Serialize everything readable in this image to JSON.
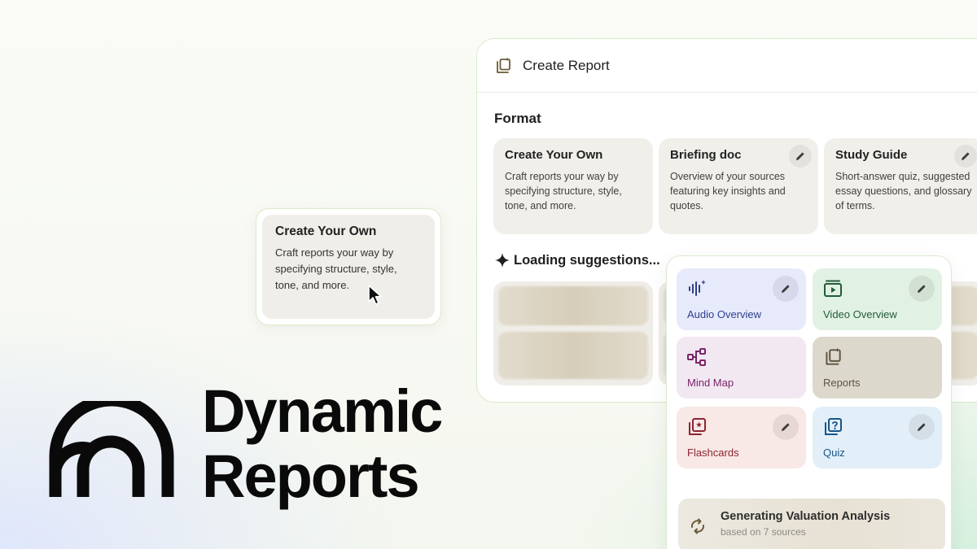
{
  "hero": {
    "title_line1": "Dynamic",
    "title_line2": "Reports",
    "logo_icon": "arches-logo-icon"
  },
  "report_panel": {
    "title": "Create Report",
    "title_icon": "report-sparkle-icon",
    "format_label": "Format",
    "format_cards": [
      {
        "title": "Create Your Own",
        "description": "Craft reports your way by specifying structure, style, tone, and more.",
        "editable": false
      },
      {
        "title": "Briefing doc",
        "description": "Overview of your sources featuring key insights and quotes.",
        "editable": true
      },
      {
        "title": "Study Guide",
        "description": "Short-answer quiz, suggested essay questions, and glossary of terms.",
        "editable": true
      }
    ],
    "loading_label": "Loading suggestions...",
    "loading_icon": "sparkle-icon"
  },
  "floating_card": {
    "title": "Create Your Own",
    "description": "Craft reports your way by specifying structure, style, tone, and more."
  },
  "tools_panel": {
    "tiles": [
      {
        "label": "Audio Overview",
        "icon": "audio-wave-icon",
        "editable": true,
        "color": "#2f3f8c"
      },
      {
        "label": "Video Overview",
        "icon": "video-play-icon",
        "editable": true,
        "color": "#235c39"
      },
      {
        "label": "Mind Map",
        "icon": "mind-map-icon",
        "editable": false,
        "color": "#7a2468"
      },
      {
        "label": "Reports",
        "icon": "report-sparkle-icon",
        "editable": false,
        "color": "#5e5540"
      },
      {
        "label": "Flashcards",
        "icon": "flashcards-icon",
        "editable": true,
        "color": "#8e2532"
      },
      {
        "label": "Quiz",
        "icon": "quiz-icon",
        "editable": true,
        "color": "#17558a"
      }
    ],
    "progress": {
      "title": "Generating Valuation Analysis",
      "subtitle": "based on 7 sources",
      "icon": "sync-icon"
    }
  }
}
